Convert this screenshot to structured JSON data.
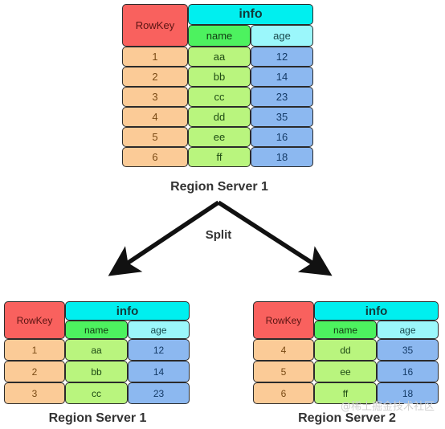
{
  "diagram": {
    "split_label": "Split",
    "watermark": "@稀土掘金技术社区"
  },
  "columns": {
    "rowkey": "RowKey",
    "family": "info",
    "qualifier_name": "name",
    "qualifier_age": "age"
  },
  "main_table": {
    "caption": "Region Server 1",
    "rows": [
      {
        "rowkey": "1",
        "name": "aa",
        "age": "12"
      },
      {
        "rowkey": "2",
        "name": "bb",
        "age": "14"
      },
      {
        "rowkey": "3",
        "name": "cc",
        "age": "23"
      },
      {
        "rowkey": "4",
        "name": "dd",
        "age": "35"
      },
      {
        "rowkey": "5",
        "name": "ee",
        "age": "16"
      },
      {
        "rowkey": "6",
        "name": "ff",
        "age": "18"
      }
    ]
  },
  "left_table": {
    "caption": "Region Server 1",
    "rows": [
      {
        "rowkey": "1",
        "name": "aa",
        "age": "12"
      },
      {
        "rowkey": "2",
        "name": "bb",
        "age": "14"
      },
      {
        "rowkey": "3",
        "name": "cc",
        "age": "23"
      }
    ]
  },
  "right_table": {
    "caption": "Region Server 2",
    "rows": [
      {
        "rowkey": "4",
        "name": "dd",
        "age": "35"
      },
      {
        "rowkey": "5",
        "name": "ee",
        "age": "16"
      },
      {
        "rowkey": "6",
        "name": "ff",
        "age": "18"
      }
    ]
  },
  "colors": {
    "rowkey_header": "#f9615e",
    "family_header": "#00efef",
    "name_header": "#4df25f",
    "age_header": "#9bf7fb",
    "rowkey_cell": "#fbcb97",
    "name_cell": "#b9f57e",
    "age_cell": "#8cb8f0",
    "border": "#2b2b2b",
    "arrow": "#111111"
  }
}
